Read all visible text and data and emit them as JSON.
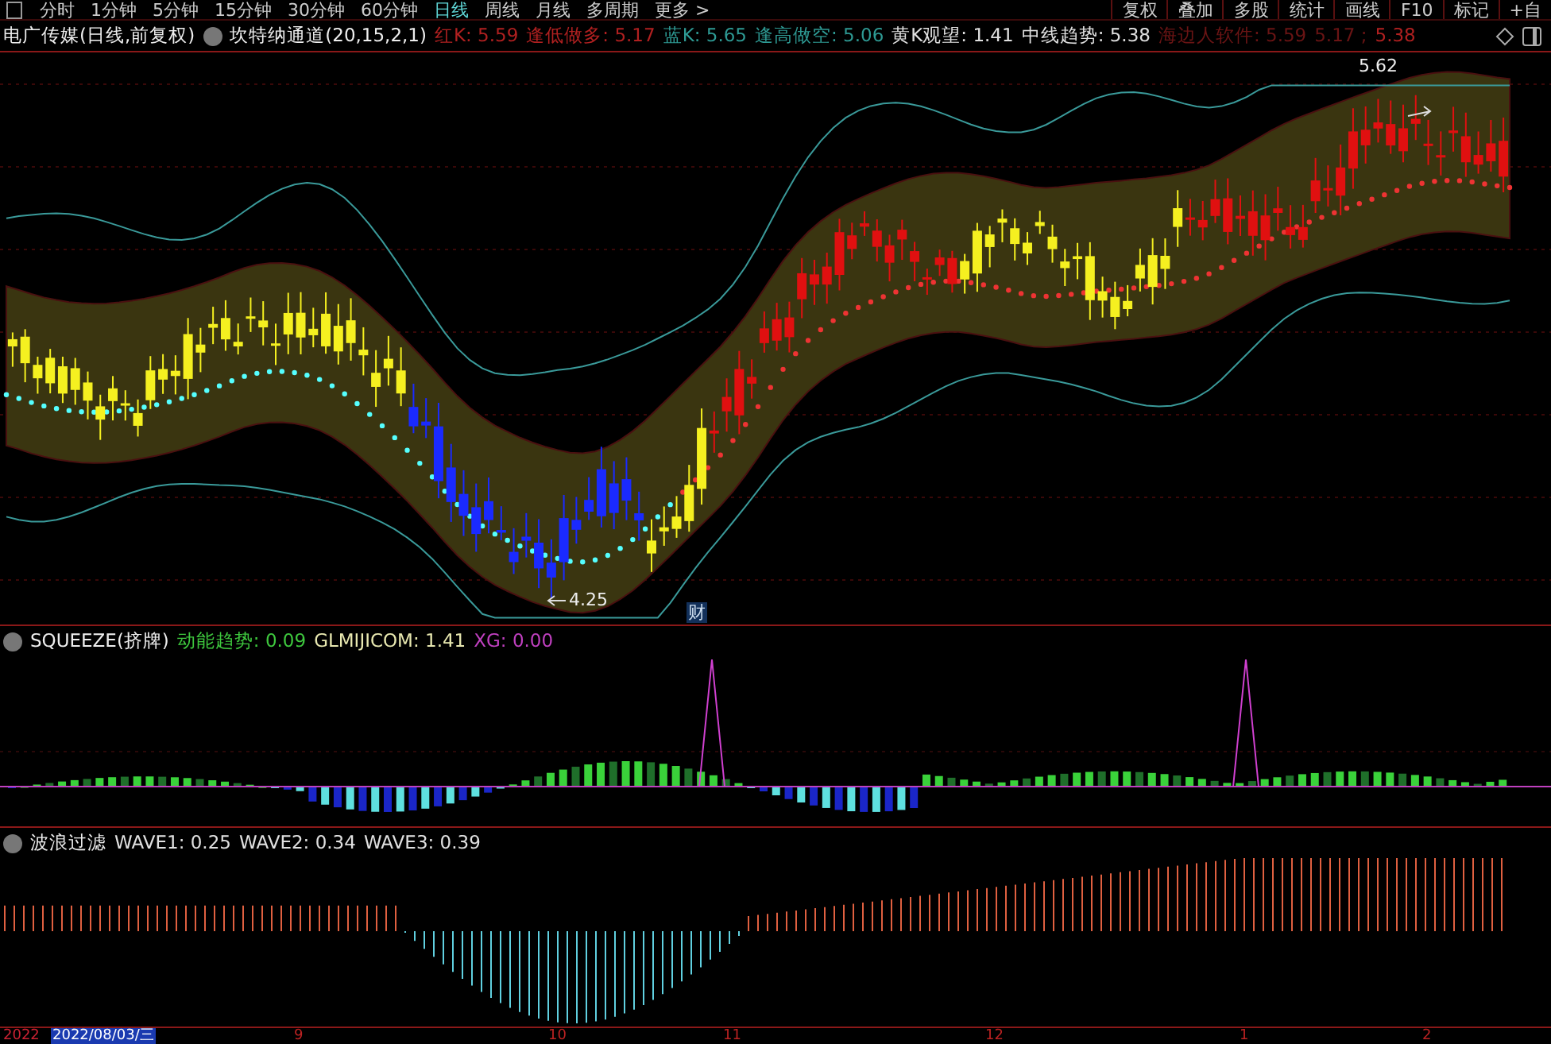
{
  "toolbar": {
    "periods": [
      {
        "label": "分时",
        "selected": false
      },
      {
        "label": "1分钟",
        "selected": false
      },
      {
        "label": "5分钟",
        "selected": false
      },
      {
        "label": "15分钟",
        "selected": false
      },
      {
        "label": "30分钟",
        "selected": false
      },
      {
        "label": "60分钟",
        "selected": false
      },
      {
        "label": "日线",
        "selected": true
      },
      {
        "label": "周线",
        "selected": false
      },
      {
        "label": "月线",
        "selected": false
      },
      {
        "label": "多周期",
        "selected": false
      },
      {
        "label": "更多 >",
        "selected": false
      }
    ],
    "buttons": [
      "复权",
      "叠加",
      "多股",
      "统计",
      "画线",
      "F10",
      "标记",
      "+自"
    ]
  },
  "main_panel": {
    "title": "电广传媒(日线,前复权)",
    "indicator": "坎特纳通道(20,15,2,1)",
    "readings": [
      {
        "text": "红K: 5.59",
        "kind": "buy"
      },
      {
        "text": "逢低做多: 5.17",
        "kind": "buy"
      },
      {
        "text": "蓝K: 5.65",
        "kind": "sell"
      },
      {
        "text": "逢高做空: 5.06",
        "kind": "sell"
      },
      {
        "text": "黄K观望: 1.41",
        "kind": "neutral"
      },
      {
        "text": "中线趋势: 5.38",
        "kind": "neutral"
      },
      {
        "text": "海边人软件: 5.59",
        "kind": "faint"
      },
      {
        "text": "5.17 ;",
        "kind": "faint"
      },
      {
        "text": "5.38",
        "kind": "buy"
      }
    ],
    "high_label": "5.62",
    "low_label": "4.25",
    "event_marker": "财"
  },
  "squeeze_panel": {
    "title": "SQUEEZE(挤牌)",
    "readings": [
      {
        "text": "动能趋势: 0.09",
        "kind": "momentum"
      },
      {
        "text": "GLMIJICOM: 1.41",
        "kind": "level"
      },
      {
        "text": "XG: 0.00",
        "kind": "signal"
      }
    ]
  },
  "wave_panel": {
    "title": "波浪过滤",
    "readings": [
      {
        "text": "WAVE1: 0.25",
        "kind": "neutral"
      },
      {
        "text": "WAVE2: 0.34",
        "kind": "neutral"
      },
      {
        "text": "WAVE3: 0.39",
        "kind": "neutral"
      }
    ]
  },
  "date_axis": {
    "start": "2022",
    "cursor_date": "2022/08/03/三",
    "ticks": [
      "9",
      "10",
      "11",
      "12",
      "1",
      "2"
    ]
  }
}
